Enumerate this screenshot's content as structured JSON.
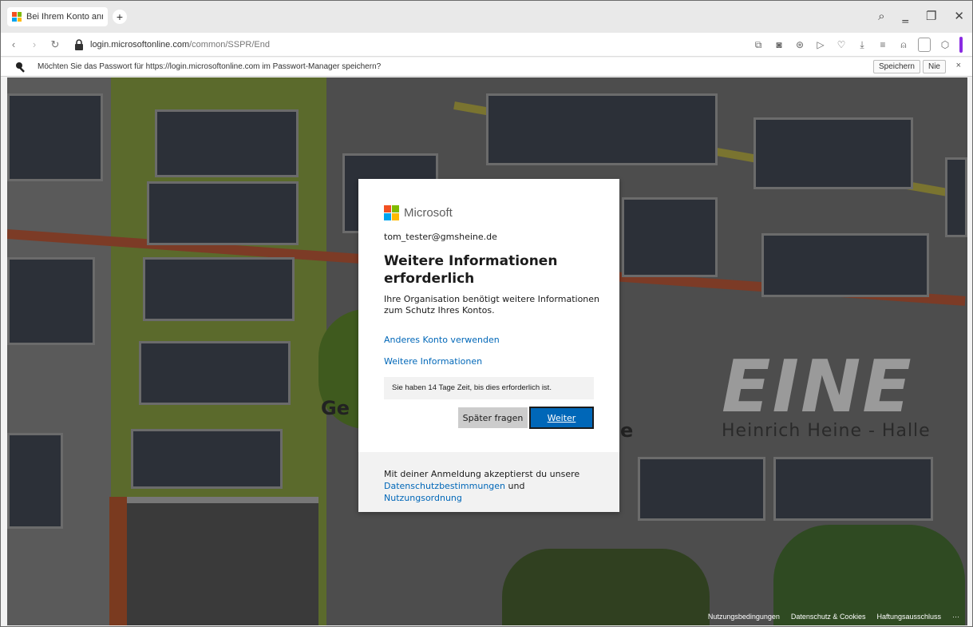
{
  "browser": {
    "tab_title": "Bei Ihrem Konto anmelde",
    "new_tab_symbol": "+",
    "url_host": "login.microsoftonline.com",
    "url_path": "/common/SSPR/End"
  },
  "password_prompt": {
    "message": "Möchten Sie das Passwort für https://login.microsoftonline.com im Passwort-Manager speichern?",
    "save_label": "Speichern",
    "never_label": "Nie",
    "close_label": "×"
  },
  "dialog": {
    "brand": "Microsoft",
    "email": "tom_tester@gmsheine.de",
    "heading": "Weitere Informationen erforderlich",
    "description": "Ihre Organisation benötigt weitere Informationen zum Schutz Ihres Kontos.",
    "link_other_account": "Anderes Konto verwenden",
    "link_more_info": "Weitere Informationen",
    "notice": "Sie haben 14 Tage Zeit, bis dies erforderlich ist.",
    "btn_later": "Später fragen",
    "btn_next": "Weiter",
    "footer_text": "Mit deiner Anmeldung akzeptierst du unsere",
    "footer_link_privacy": "Datenschutzbestimmungen",
    "footer_and": "und",
    "footer_link_terms": "Nutzungsordnung"
  },
  "background_text": {
    "heine": "EINE",
    "heine_sub": "Heinrich Heine - Halle",
    "ge": "Ge",
    "ee": "e"
  },
  "page_footer": {
    "terms": "Nutzungsbedingungen",
    "privacy": "Datenschutz & Cookies",
    "imprint": "Haftungsausschluss",
    "more": "···"
  },
  "colors": {
    "ms_red": "#f25022",
    "ms_green": "#7fba00",
    "ms_blue": "#00a4ef",
    "ms_yellow": "#ffb900",
    "accent": "#0067b8"
  }
}
